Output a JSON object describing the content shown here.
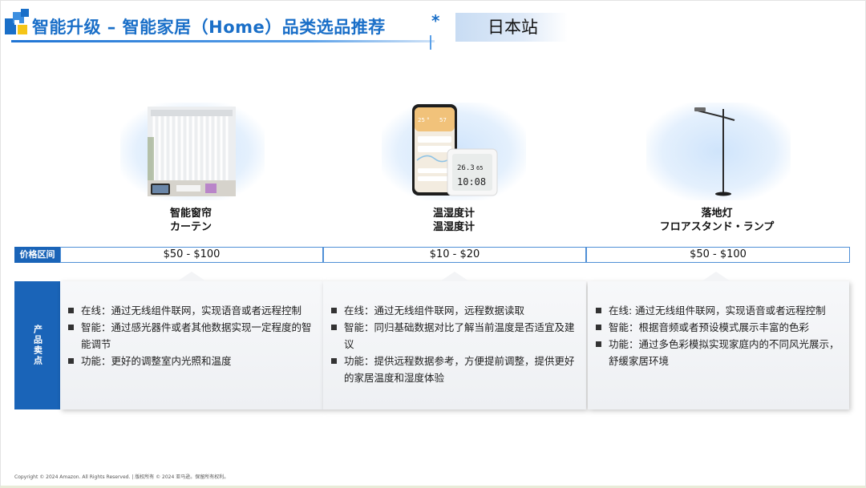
{
  "header": {
    "title": "智能升级 – 智能家居（Home）品类选品推荐",
    "star": "*",
    "site": "日本站"
  },
  "colors": {
    "accent": "#1a6fc8",
    "label_bg": "#1a64b8"
  },
  "labels": {
    "price": "价格区间",
    "features": "产品卖点"
  },
  "products": [
    {
      "name_cn": "智能窗帘",
      "name_jp": "カーテン",
      "image": "curtain-image",
      "price": "$50 - $100",
      "features": [
        "在线：通过无线组件联网，实现语音或者远程控制",
        "智能：通过感光器件或者其他数据实现一定程度的智能调节",
        "功能：更好的调整室内光照和温度"
      ]
    },
    {
      "name_cn": "温湿度计",
      "name_jp": "温湿度计",
      "image": "thermo-hygrometer-image",
      "price": "$10 - $20",
      "features": [
        "在线：通过无线组件联网，远程数据读取",
        "智能：同归基础数据对比了解当前温度是否适宜及建议",
        "功能：提供远程数据参考，方便提前调整，提供更好的家居温度和湿度体验"
      ]
    },
    {
      "name_cn": "落地灯",
      "name_jp": "フロアスタンド・ランプ",
      "image": "floor-lamp-image",
      "price": "$50 - $100",
      "features": [
        "在线: 通过无线组件联网，实现语音或者远程控制",
        "智能：根据音频或者预设模式展示丰富的色彩",
        "功能：通过多色彩模拟实现家庭内的不同风光展示，舒缓家居环境"
      ]
    }
  ],
  "device": {
    "phone_time": "25 °",
    "phone_hum": "57",
    "screen_temp": "26.3",
    "screen_hum": "65",
    "screen_time": "10:08"
  },
  "footer": "Copyright © 2024 Amazon. All Rights Reserved. | 版权所有 © 2024 亚马逊。保留所有权利。"
}
